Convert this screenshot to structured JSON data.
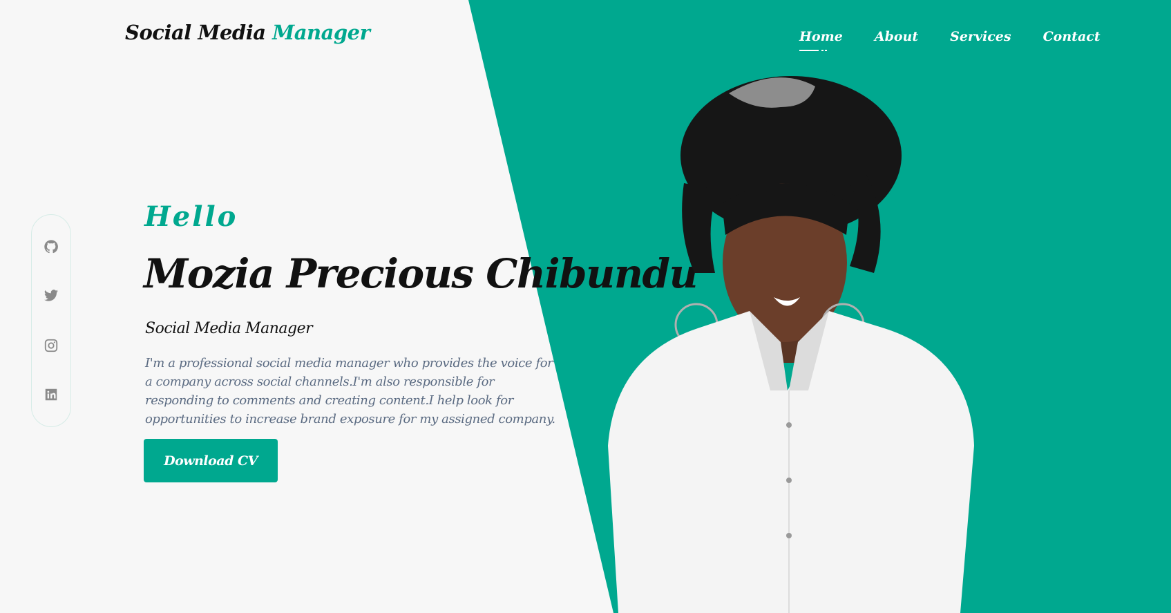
{
  "brand": {
    "logo_primary": "Social Media",
    "logo_accent": "Manager",
    "accent_color": "#00a88f"
  },
  "nav": {
    "items": [
      {
        "label": "Home",
        "active": true
      },
      {
        "label": "About",
        "active": false
      },
      {
        "label": "Services",
        "active": false
      },
      {
        "label": "Contact",
        "active": false
      }
    ]
  },
  "social": {
    "icons": [
      "github-icon",
      "twitter-icon",
      "instagram-icon",
      "linkedin-icon"
    ]
  },
  "hero": {
    "greeting": "Hello",
    "name": "Mozia Precious Chibundu",
    "role": "Social Media Manager",
    "bio": "I'm a professional social media manager who provides the voice for a company across social channels.I'm also responsible for responding to comments and creating content.I help look for opportunities to increase brand exposure for my assigned company.",
    "cta_label": "Download CV"
  }
}
